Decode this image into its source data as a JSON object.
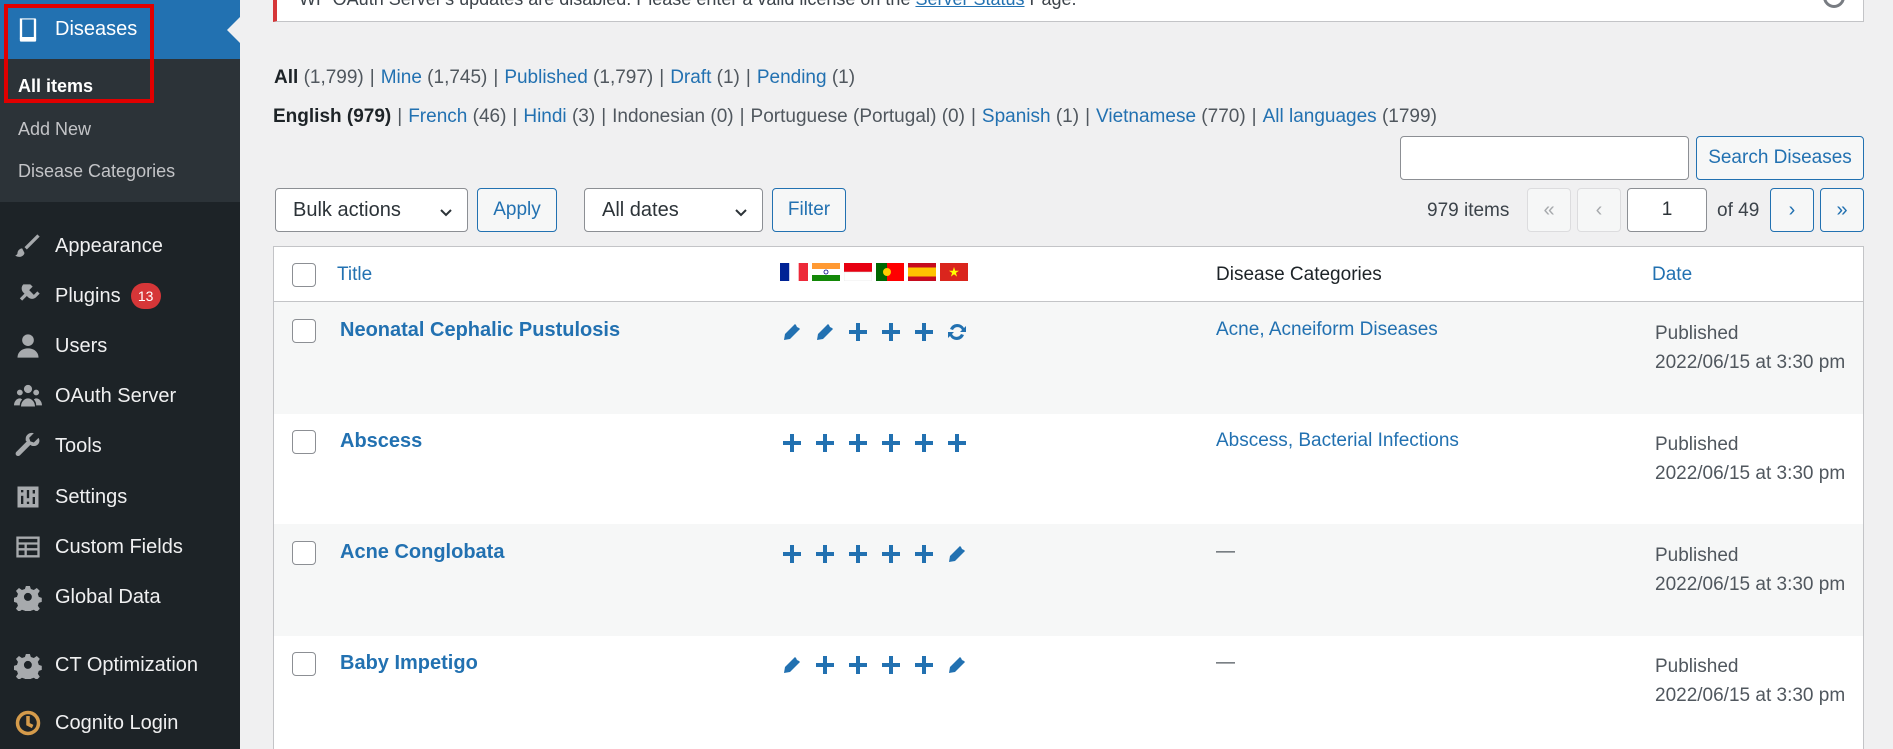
{
  "sidebar": {
    "post_type_menu": "Diseases",
    "submenu": [
      "All items",
      "Add New",
      "Disease Categories"
    ],
    "items": [
      {
        "label": "Appearance",
        "icon": "paintbrush-icon"
      },
      {
        "label": "Plugins",
        "icon": "plugin-icon",
        "badge": "13"
      },
      {
        "label": "Users",
        "icon": "user-icon"
      },
      {
        "label": "OAuth Server",
        "icon": "groups-icon"
      },
      {
        "label": "Tools",
        "icon": "wrench-icon"
      },
      {
        "label": "Settings",
        "icon": "settings-sliders-icon"
      },
      {
        "label": "Custom Fields",
        "icon": "table-icon"
      },
      {
        "label": "Global Data",
        "icon": "gear-icon"
      },
      {
        "label": "CT Optimization",
        "icon": "gear-icon"
      },
      {
        "label": "Cognito Login",
        "icon": "cognito-logo-icon"
      }
    ]
  },
  "notice": {
    "text_before": "WP OAuth Server's updates are disabled. Please enter a valid license on the ",
    "link": "Server Status",
    "text_after": " Page."
  },
  "status_filters": [
    {
      "label": "All",
      "count": "(1,799)",
      "current": true
    },
    {
      "label": "Mine",
      "count": "(1,745)"
    },
    {
      "label": "Published",
      "count": "(1,797)"
    },
    {
      "label": "Draft",
      "count": "(1)"
    },
    {
      "label": "Pending",
      "count": "(1)"
    }
  ],
  "language_filters": [
    {
      "label": "English",
      "count": "(979)",
      "current": true
    },
    {
      "label": "French",
      "count": "(46)"
    },
    {
      "label": "Hindi",
      "count": "(3)"
    },
    {
      "label": "Indonesian",
      "count": "(0)",
      "plain": true
    },
    {
      "label": "Portuguese (Portugal)",
      "count": "(0)",
      "plain": true
    },
    {
      "label": "Spanish",
      "count": "(1)"
    },
    {
      "label": "Vietnamese",
      "count": "(770)"
    },
    {
      "label": "All languages",
      "count": "(1799)"
    }
  ],
  "search": {
    "button": "Search Diseases",
    "value": ""
  },
  "toolbar": {
    "bulk_actions": "Bulk actions",
    "apply": "Apply",
    "dates": "All dates",
    "filter": "Filter"
  },
  "pagination": {
    "items": "979 items",
    "first": "«",
    "prev": "‹",
    "current_page": "1",
    "of": "of 49",
    "next": "›",
    "last": "»"
  },
  "table": {
    "headers": {
      "title": "Title",
      "categories": "Disease Categories",
      "date": "Date"
    },
    "flags": [
      "fr",
      "in",
      "id",
      "pt",
      "es",
      "vn"
    ],
    "rows": [
      {
        "title": "Neonatal Cephalic Pustulosis",
        "translations": [
          "edit",
          "edit",
          "add",
          "add",
          "add",
          "sync"
        ],
        "categories": [
          "Acne",
          "Acneiform Diseases"
        ],
        "date_status": "Published",
        "date": "2022/06/15 at 3:30 pm"
      },
      {
        "title": "Abscess",
        "translations": [
          "add",
          "add",
          "add",
          "add",
          "add",
          "add"
        ],
        "categories": [
          "Abscess",
          "Bacterial Infections"
        ],
        "date_status": "Published",
        "date": "2022/06/15 at 3:30 pm"
      },
      {
        "title": "Acne Conglobata",
        "translations": [
          "add",
          "add",
          "add",
          "add",
          "add",
          "edit"
        ],
        "categories": [],
        "date_status": "Published",
        "date": "2022/06/15 at 3:30 pm"
      },
      {
        "title": "Baby Impetigo",
        "translations": [
          "edit",
          "add",
          "add",
          "add",
          "add",
          "edit"
        ],
        "categories": [],
        "date_status": "Published",
        "date": "2022/06/15 at 3:30 pm"
      }
    ]
  },
  "colors": {
    "sidebar": "#1d2327",
    "submenu": "#2c3338",
    "accent": "#2271b1",
    "highlight": "#e10000",
    "badge": "#d63638"
  }
}
